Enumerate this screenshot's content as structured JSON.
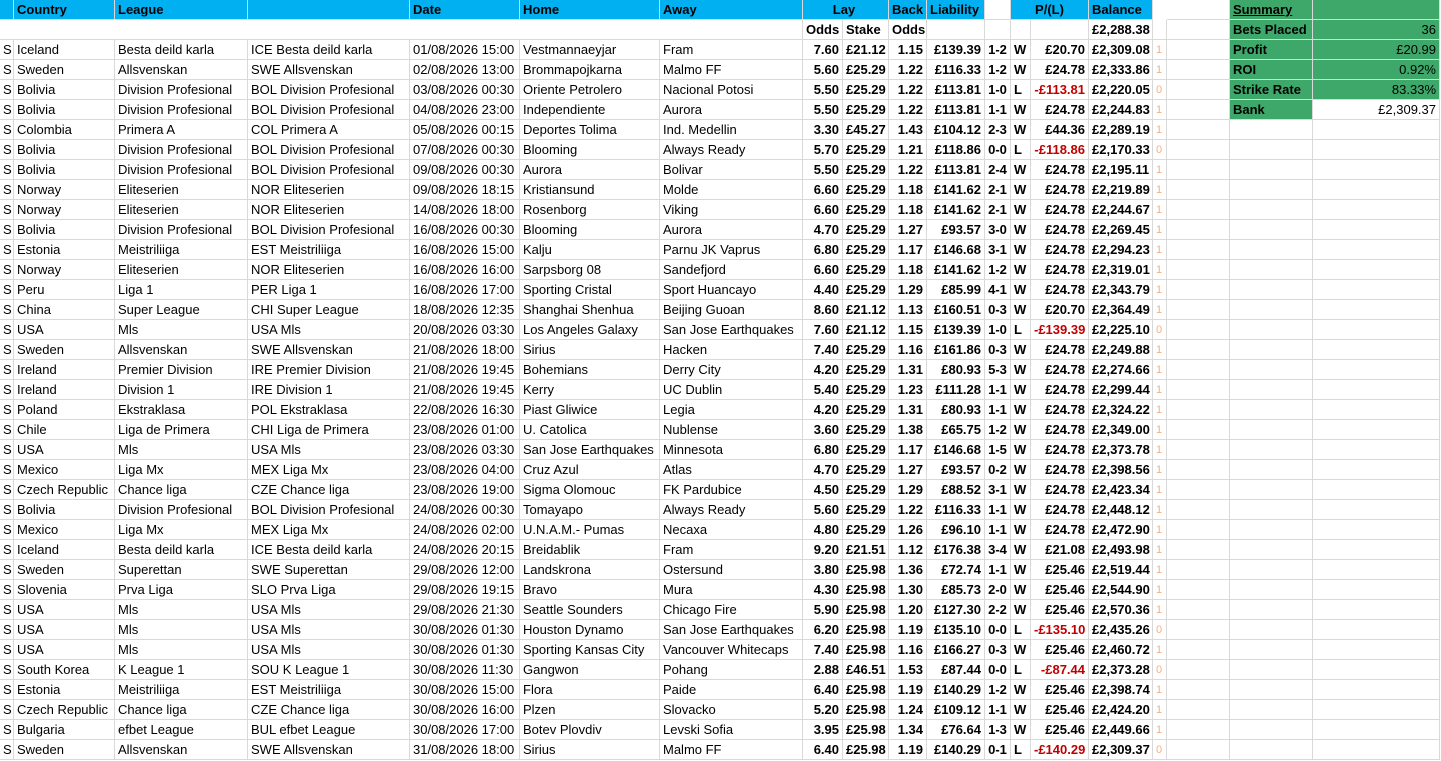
{
  "header": {
    "country": "Country",
    "league": "League",
    "date": "Date",
    "home": "Home",
    "away": "Away",
    "lay": "Lay",
    "back": "Back",
    "liability": "Liability",
    "pl": "P/(L)",
    "balance": "Balance",
    "odds_lay": "Odds",
    "stake": "Stake",
    "odds_back": "Odds",
    "start_balance": "£2,288.38"
  },
  "summary": {
    "title": "Summary",
    "rows": [
      {
        "label": "Bets Placed",
        "value": "36"
      },
      {
        "label": "Profit",
        "value": "£20.99"
      },
      {
        "label": "ROI",
        "value": "0.92%"
      },
      {
        "label": "Strike Rate",
        "value": "83.33%"
      },
      {
        "label": "Bank",
        "value": "£2,309.37"
      }
    ]
  },
  "rows": [
    {
      "s": "S",
      "country": "Iceland",
      "league": "Besta deild karla",
      "comp": "ICE Besta deild karla",
      "date": "01/08/2026 15:00",
      "home": "Vestmannaeyjar",
      "away": "Fram",
      "lay": "7.60",
      "stake": "£21.12",
      "back": "1.15",
      "liab": "£139.39",
      "score": "1-2",
      "res": "W",
      "pl": "£20.70",
      "bal": "£2,309.08",
      "flag": "1"
    },
    {
      "s": "S",
      "country": "Sweden",
      "league": "Allsvenskan",
      "comp": "SWE Allsvenskan",
      "date": "02/08/2026 13:00",
      "home": "Brommapojkarna",
      "away": "Malmo FF",
      "lay": "5.60",
      "stake": "£25.29",
      "back": "1.22",
      "liab": "£116.33",
      "score": "1-2",
      "res": "W",
      "pl": "£24.78",
      "bal": "£2,333.86",
      "flag": "1"
    },
    {
      "s": "S",
      "country": "Bolivia",
      "league": "Division Profesional",
      "comp": "BOL Division Profesional",
      "date": "03/08/2026 00:30",
      "home": "Oriente Petrolero",
      "away": "Nacional Potosi",
      "lay": "5.50",
      "stake": "£25.29",
      "back": "1.22",
      "liab": "£113.81",
      "score": "1-0",
      "res": "L",
      "pl": "-£113.81",
      "bal": "£2,220.05",
      "flag": "0"
    },
    {
      "s": "S",
      "country": "Bolivia",
      "league": "Division Profesional",
      "comp": "BOL Division Profesional",
      "date": "04/08/2026 23:00",
      "home": "Independiente",
      "away": "Aurora",
      "lay": "5.50",
      "stake": "£25.29",
      "back": "1.22",
      "liab": "£113.81",
      "score": "1-1",
      "res": "W",
      "pl": "£24.78",
      "bal": "£2,244.83",
      "flag": "1"
    },
    {
      "s": "S",
      "country": "Colombia",
      "league": "Primera A",
      "comp": "COL Primera A",
      "date": "05/08/2026 00:15",
      "home": "Deportes Tolima",
      "away": "Ind. Medellin",
      "lay": "3.30",
      "stake": "£45.27",
      "back": "1.43",
      "liab": "£104.12",
      "score": "2-3",
      "res": "W",
      "pl": "£44.36",
      "bal": "£2,289.19",
      "flag": "1"
    },
    {
      "s": "S",
      "country": "Bolivia",
      "league": "Division Profesional",
      "comp": "BOL Division Profesional",
      "date": "07/08/2026 00:30",
      "home": "Blooming",
      "away": "Always Ready",
      "lay": "5.70",
      "stake": "£25.29",
      "back": "1.21",
      "liab": "£118.86",
      "score": "0-0",
      "res": "L",
      "pl": "-£118.86",
      "bal": "£2,170.33",
      "flag": "0"
    },
    {
      "s": "S",
      "country": "Bolivia",
      "league": "Division Profesional",
      "comp": "BOL Division Profesional",
      "date": "09/08/2026 00:30",
      "home": "Aurora",
      "away": "Bolivar",
      "lay": "5.50",
      "stake": "£25.29",
      "back": "1.22",
      "liab": "£113.81",
      "score": "2-4",
      "res": "W",
      "pl": "£24.78",
      "bal": "£2,195.11",
      "flag": "1"
    },
    {
      "s": "S",
      "country": "Norway",
      "league": "Eliteserien",
      "comp": "NOR Eliteserien",
      "date": "09/08/2026 18:15",
      "home": "Kristiansund",
      "away": "Molde",
      "lay": "6.60",
      "stake": "£25.29",
      "back": "1.18",
      "liab": "£141.62",
      "score": "2-1",
      "res": "W",
      "pl": "£24.78",
      "bal": "£2,219.89",
      "flag": "1"
    },
    {
      "s": "S",
      "country": "Norway",
      "league": "Eliteserien",
      "comp": "NOR Eliteserien",
      "date": "14/08/2026 18:00",
      "home": "Rosenborg",
      "away": "Viking",
      "lay": "6.60",
      "stake": "£25.29",
      "back": "1.18",
      "liab": "£141.62",
      "score": "2-1",
      "res": "W",
      "pl": "£24.78",
      "bal": "£2,244.67",
      "flag": "1"
    },
    {
      "s": "S",
      "country": "Bolivia",
      "league": "Division Profesional",
      "comp": "BOL Division Profesional",
      "date": "16/08/2026 00:30",
      "home": "Blooming",
      "away": "Aurora",
      "lay": "4.70",
      "stake": "£25.29",
      "back": "1.27",
      "liab": "£93.57",
      "score": "3-0",
      "res": "W",
      "pl": "£24.78",
      "bal": "£2,269.45",
      "flag": "1"
    },
    {
      "s": "S",
      "country": "Estonia",
      "league": "Meistriliiga",
      "comp": "EST Meistriliiga",
      "date": "16/08/2026 15:00",
      "home": "Kalju",
      "away": "Parnu JK Vaprus",
      "lay": "6.80",
      "stake": "£25.29",
      "back": "1.17",
      "liab": "£146.68",
      "score": "3-1",
      "res": "W",
      "pl": "£24.78",
      "bal": "£2,294.23",
      "flag": "1"
    },
    {
      "s": "S",
      "country": "Norway",
      "league": "Eliteserien",
      "comp": "NOR Eliteserien",
      "date": "16/08/2026 16:00",
      "home": "Sarpsborg 08",
      "away": "Sandefjord",
      "lay": "6.60",
      "stake": "£25.29",
      "back": "1.18",
      "liab": "£141.62",
      "score": "1-2",
      "res": "W",
      "pl": "£24.78",
      "bal": "£2,319.01",
      "flag": "1"
    },
    {
      "s": "S",
      "country": "Peru",
      "league": "Liga 1",
      "comp": "PER Liga 1",
      "date": "16/08/2026 17:00",
      "home": "Sporting Cristal",
      "away": "Sport Huancayo",
      "lay": "4.40",
      "stake": "£25.29",
      "back": "1.29",
      "liab": "£85.99",
      "score": "4-1",
      "res": "W",
      "pl": "£24.78",
      "bal": "£2,343.79",
      "flag": "1"
    },
    {
      "s": "S",
      "country": "China",
      "league": "Super League",
      "comp": "CHI Super League",
      "date": "18/08/2026 12:35",
      "home": "Shanghai Shenhua",
      "away": "Beijing Guoan",
      "lay": "8.60",
      "stake": "£21.12",
      "back": "1.13",
      "liab": "£160.51",
      "score": "0-3",
      "res": "W",
      "pl": "£20.70",
      "bal": "£2,364.49",
      "flag": "1"
    },
    {
      "s": "S",
      "country": "USA",
      "league": "Mls",
      "comp": "USA Mls",
      "date": "20/08/2026 03:30",
      "home": "Los Angeles Galaxy",
      "away": "San Jose Earthquakes",
      "lay": "7.60",
      "stake": "£21.12",
      "back": "1.15",
      "liab": "£139.39",
      "score": "1-0",
      "res": "L",
      "pl": "-£139.39",
      "bal": "£2,225.10",
      "flag": "0"
    },
    {
      "s": "S",
      "country": "Sweden",
      "league": "Allsvenskan",
      "comp": "SWE Allsvenskan",
      "date": "21/08/2026 18:00",
      "home": "Sirius",
      "away": "Hacken",
      "lay": "7.40",
      "stake": "£25.29",
      "back": "1.16",
      "liab": "£161.86",
      "score": "0-3",
      "res": "W",
      "pl": "£24.78",
      "bal": "£2,249.88",
      "flag": "1"
    },
    {
      "s": "S",
      "country": "Ireland",
      "league": "Premier Division",
      "comp": "IRE Premier Division",
      "date": "21/08/2026 19:45",
      "home": "Bohemians",
      "away": "Derry City",
      "lay": "4.20",
      "stake": "£25.29",
      "back": "1.31",
      "liab": "£80.93",
      "score": "5-3",
      "res": "W",
      "pl": "£24.78",
      "bal": "£2,274.66",
      "flag": "1"
    },
    {
      "s": "S",
      "country": "Ireland",
      "league": "Division 1",
      "comp": "IRE Division 1",
      "date": "21/08/2026 19:45",
      "home": "Kerry",
      "away": "UC Dublin",
      "lay": "5.40",
      "stake": "£25.29",
      "back": "1.23",
      "liab": "£111.28",
      "score": "1-1",
      "res": "W",
      "pl": "£24.78",
      "bal": "£2,299.44",
      "flag": "1"
    },
    {
      "s": "S",
      "country": "Poland",
      "league": "Ekstraklasa",
      "comp": "POL Ekstraklasa",
      "date": "22/08/2026 16:30",
      "home": "Piast Gliwice",
      "away": "Legia",
      "lay": "4.20",
      "stake": "£25.29",
      "back": "1.31",
      "liab": "£80.93",
      "score": "1-1",
      "res": "W",
      "pl": "£24.78",
      "bal": "£2,324.22",
      "flag": "1"
    },
    {
      "s": "S",
      "country": "Chile",
      "league": "Liga de Primera",
      "comp": "CHI Liga de Primera",
      "date": "23/08/2026 01:00",
      "home": "U. Catolica",
      "away": "Nublense",
      "lay": "3.60",
      "stake": "£25.29",
      "back": "1.38",
      "liab": "£65.75",
      "score": "1-2",
      "res": "W",
      "pl": "£24.78",
      "bal": "£2,349.00",
      "flag": "1"
    },
    {
      "s": "S",
      "country": "USA",
      "league": "Mls",
      "comp": "USA Mls",
      "date": "23/08/2026 03:30",
      "home": "San Jose Earthquakes",
      "away": "Minnesota",
      "lay": "6.80",
      "stake": "£25.29",
      "back": "1.17",
      "liab": "£146.68",
      "score": "1-5",
      "res": "W",
      "pl": "£24.78",
      "bal": "£2,373.78",
      "flag": "1"
    },
    {
      "s": "S",
      "country": "Mexico",
      "league": "Liga Mx",
      "comp": "MEX Liga Mx",
      "date": "23/08/2026 04:00",
      "home": "Cruz Azul",
      "away": "Atlas",
      "lay": "4.70",
      "stake": "£25.29",
      "back": "1.27",
      "liab": "£93.57",
      "score": "0-2",
      "res": "W",
      "pl": "£24.78",
      "bal": "£2,398.56",
      "flag": "1"
    },
    {
      "s": "S",
      "country": "Czech Republic",
      "league": "Chance liga",
      "comp": "CZE Chance liga",
      "date": "23/08/2026 19:00",
      "home": "Sigma Olomouc",
      "away": "FK Pardubice",
      "lay": "4.50",
      "stake": "£25.29",
      "back": "1.29",
      "liab": "£88.52",
      "score": "3-1",
      "res": "W",
      "pl": "£24.78",
      "bal": "£2,423.34",
      "flag": "1"
    },
    {
      "s": "S",
      "country": "Bolivia",
      "league": "Division Profesional",
      "comp": "BOL Division Profesional",
      "date": "24/08/2026 00:30",
      "home": "Tomayapo",
      "away": "Always Ready",
      "lay": "5.60",
      "stake": "£25.29",
      "back": "1.22",
      "liab": "£116.33",
      "score": "1-1",
      "res": "W",
      "pl": "£24.78",
      "bal": "£2,448.12",
      "flag": "1"
    },
    {
      "s": "S",
      "country": "Mexico",
      "league": "Liga Mx",
      "comp": "MEX Liga Mx",
      "date": "24/08/2026 02:00",
      "home": "U.N.A.M.- Pumas",
      "away": "Necaxa",
      "lay": "4.80",
      "stake": "£25.29",
      "back": "1.26",
      "liab": "£96.10",
      "score": "1-1",
      "res": "W",
      "pl": "£24.78",
      "bal": "£2,472.90",
      "flag": "1"
    },
    {
      "s": "S",
      "country": "Iceland",
      "league": "Besta deild karla",
      "comp": "ICE Besta deild karla",
      "date": "24/08/2026 20:15",
      "home": "Breidablik",
      "away": "Fram",
      "lay": "9.20",
      "stake": "£21.51",
      "back": "1.12",
      "liab": "£176.38",
      "score": "3-4",
      "res": "W",
      "pl": "£21.08",
      "bal": "£2,493.98",
      "flag": "1"
    },
    {
      "s": "S",
      "country": "Sweden",
      "league": "Superettan",
      "comp": "SWE Superettan",
      "date": "29/08/2026 12:00",
      "home": "Landskrona",
      "away": "Ostersund",
      "lay": "3.80",
      "stake": "£25.98",
      "back": "1.36",
      "liab": "£72.74",
      "score": "1-1",
      "res": "W",
      "pl": "£25.46",
      "bal": "£2,519.44",
      "flag": "1"
    },
    {
      "s": "S",
      "country": "Slovenia",
      "league": "Prva Liga",
      "comp": "SLO Prva Liga",
      "date": "29/08/2026 19:15",
      "home": "Bravo",
      "away": "Mura",
      "lay": "4.30",
      "stake": "£25.98",
      "back": "1.30",
      "liab": "£85.73",
      "score": "2-0",
      "res": "W",
      "pl": "£25.46",
      "bal": "£2,544.90",
      "flag": "1"
    },
    {
      "s": "S",
      "country": "USA",
      "league": "Mls",
      "comp": "USA Mls",
      "date": "29/08/2026 21:30",
      "home": "Seattle Sounders",
      "away": "Chicago Fire",
      "lay": "5.90",
      "stake": "£25.98",
      "back": "1.20",
      "liab": "£127.30",
      "score": "2-2",
      "res": "W",
      "pl": "£25.46",
      "bal": "£2,570.36",
      "flag": "1"
    },
    {
      "s": "S",
      "country": "USA",
      "league": "Mls",
      "comp": "USA Mls",
      "date": "30/08/2026 01:30",
      "home": "Houston Dynamo",
      "away": "San Jose Earthquakes",
      "lay": "6.20",
      "stake": "£25.98",
      "back": "1.19",
      "liab": "£135.10",
      "score": "0-0",
      "res": "L",
      "pl": "-£135.10",
      "bal": "£2,435.26",
      "flag": "0"
    },
    {
      "s": "S",
      "country": "USA",
      "league": "Mls",
      "comp": "USA Mls",
      "date": "30/08/2026 01:30",
      "home": "Sporting Kansas City",
      "away": "Vancouver Whitecaps",
      "lay": "7.40",
      "stake": "£25.98",
      "back": "1.16",
      "liab": "£166.27",
      "score": "0-3",
      "res": "W",
      "pl": "£25.46",
      "bal": "£2,460.72",
      "flag": "1"
    },
    {
      "s": "S",
      "country": "South Korea",
      "league": "K League 1",
      "comp": "SOU K League 1",
      "date": "30/08/2026 11:30",
      "home": "Gangwon",
      "away": "Pohang",
      "lay": "2.88",
      "stake": "£46.51",
      "back": "1.53",
      "liab": "£87.44",
      "score": "0-0",
      "res": "L",
      "pl": "-£87.44",
      "bal": "£2,373.28",
      "flag": "0"
    },
    {
      "s": "S",
      "country": "Estonia",
      "league": "Meistriliiga",
      "comp": "EST Meistriliiga",
      "date": "30/08/2026 15:00",
      "home": "Flora",
      "away": "Paide",
      "lay": "6.40",
      "stake": "£25.98",
      "back": "1.19",
      "liab": "£140.29",
      "score": "1-2",
      "res": "W",
      "pl": "£25.46",
      "bal": "£2,398.74",
      "flag": "1"
    },
    {
      "s": "S",
      "country": "Czech Republic",
      "league": "Chance liga",
      "comp": "CZE Chance liga",
      "date": "30/08/2026 16:00",
      "home": "Plzen",
      "away": "Slovacko",
      "lay": "5.20",
      "stake": "£25.98",
      "back": "1.24",
      "liab": "£109.12",
      "score": "1-1",
      "res": "W",
      "pl": "£25.46",
      "bal": "£2,424.20",
      "flag": "1"
    },
    {
      "s": "S",
      "country": "Bulgaria",
      "league": "efbet League",
      "comp": "BUL efbet League",
      "date": "30/08/2026 17:00",
      "home": "Botev Plovdiv",
      "away": "Levski Sofia",
      "lay": "3.95",
      "stake": "£25.98",
      "back": "1.34",
      "liab": "£76.64",
      "score": "1-3",
      "res": "W",
      "pl": "£25.46",
      "bal": "£2,449.66",
      "flag": "1"
    },
    {
      "s": "S",
      "country": "Sweden",
      "league": "Allsvenskan",
      "comp": "SWE Allsvenskan",
      "date": "31/08/2026 18:00",
      "home": "Sirius",
      "away": "Malmo FF",
      "lay": "6.40",
      "stake": "£25.98",
      "back": "1.19",
      "liab": "£140.29",
      "score": "0-1",
      "res": "L",
      "pl": "-£140.29",
      "bal": "£2,309.37",
      "flag": "0"
    }
  ]
}
